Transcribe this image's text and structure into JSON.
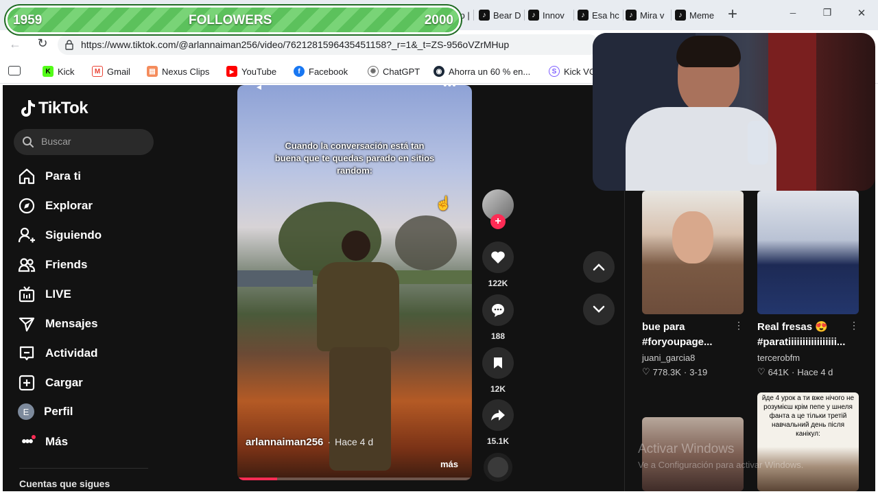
{
  "goal": {
    "current": "1959",
    "label": "FOLLOWERS",
    "target": "2000"
  },
  "browser": {
    "tabs": [
      {
        "label": "yp |"
      },
      {
        "label": "Bear D"
      },
      {
        "label": "Innov"
      },
      {
        "label": "Esa hc"
      },
      {
        "label": "Mira v"
      },
      {
        "label": "Meme"
      }
    ],
    "new_tab": "+",
    "window_controls": {
      "minimize": "─",
      "restore": "❐",
      "close": "✕"
    },
    "url": "https://www.tiktok.com/@arlannaiman256/video/7621281596435451158?_r=1&_t=ZS-956oVZrMHup",
    "bookmarks": [
      {
        "label": "Kick",
        "color": "#53fc18"
      },
      {
        "label": "Gmail",
        "color": "#ea4335"
      },
      {
        "label": "Nexus Clips",
        "color": "#f48c5c"
      },
      {
        "label": "YouTube",
        "color": "#ff0000"
      },
      {
        "label": "Facebook",
        "color": "#1877f2"
      },
      {
        "label": "ChatGPT",
        "color": "#6b6b6b"
      },
      {
        "label": "Ahorra un 60 % en...",
        "color": "#1b2838"
      },
      {
        "label": "Kick VO",
        "color": "#7c5cff"
      }
    ]
  },
  "tiktok": {
    "logo": "TikTok",
    "search_placeholder": "Buscar",
    "nav": [
      {
        "label": "Para ti",
        "icon": "home-icon"
      },
      {
        "label": "Explorar",
        "icon": "compass-icon"
      },
      {
        "label": "Siguiendo",
        "icon": "user-follow-icon"
      },
      {
        "label": "Friends",
        "icon": "friends-icon"
      },
      {
        "label": "LIVE",
        "icon": "live-tv-icon"
      },
      {
        "label": "Mensajes",
        "icon": "send-icon"
      },
      {
        "label": "Actividad",
        "icon": "activity-icon"
      },
      {
        "label": "Cargar",
        "icon": "upload-icon"
      },
      {
        "label": "Perfil",
        "icon": "profile-avatar-icon",
        "avatar_letter": "E"
      },
      {
        "label": "Más",
        "icon": "more-icon"
      }
    ],
    "following_heading": "Cuentas que sigues",
    "video": {
      "caption": "Cuando la conversación está tan buena que te quedas parado en sitios random:",
      "author": "arlannaiman256",
      "time": "Hace 4 d",
      "more": "más",
      "progress": 0.17
    },
    "actions": {
      "likes": "122K",
      "comments": "188",
      "saves": "12K",
      "shares": "15.1K"
    },
    "cards": [
      {
        "title": "bue para #foryoupage...",
        "author": "juani_garcia8",
        "likes": "778.3K",
        "date": "3-19"
      },
      {
        "title": "Real fresas 😍 #paratiiiiiiiiiiiiiiiii...",
        "author": "tercerobfm",
        "likes": "641K",
        "date": "Hace 4 d"
      },
      {
        "overlay": "йде 4 урок а ти вже нічого не розумієш крім пепе у шнеля фанта а це тільки третій навчальний день після канікул:"
      }
    ],
    "watermark": {
      "line1": "Activar Windows",
      "line2": "Ve a Configuración para activar Windows."
    }
  }
}
